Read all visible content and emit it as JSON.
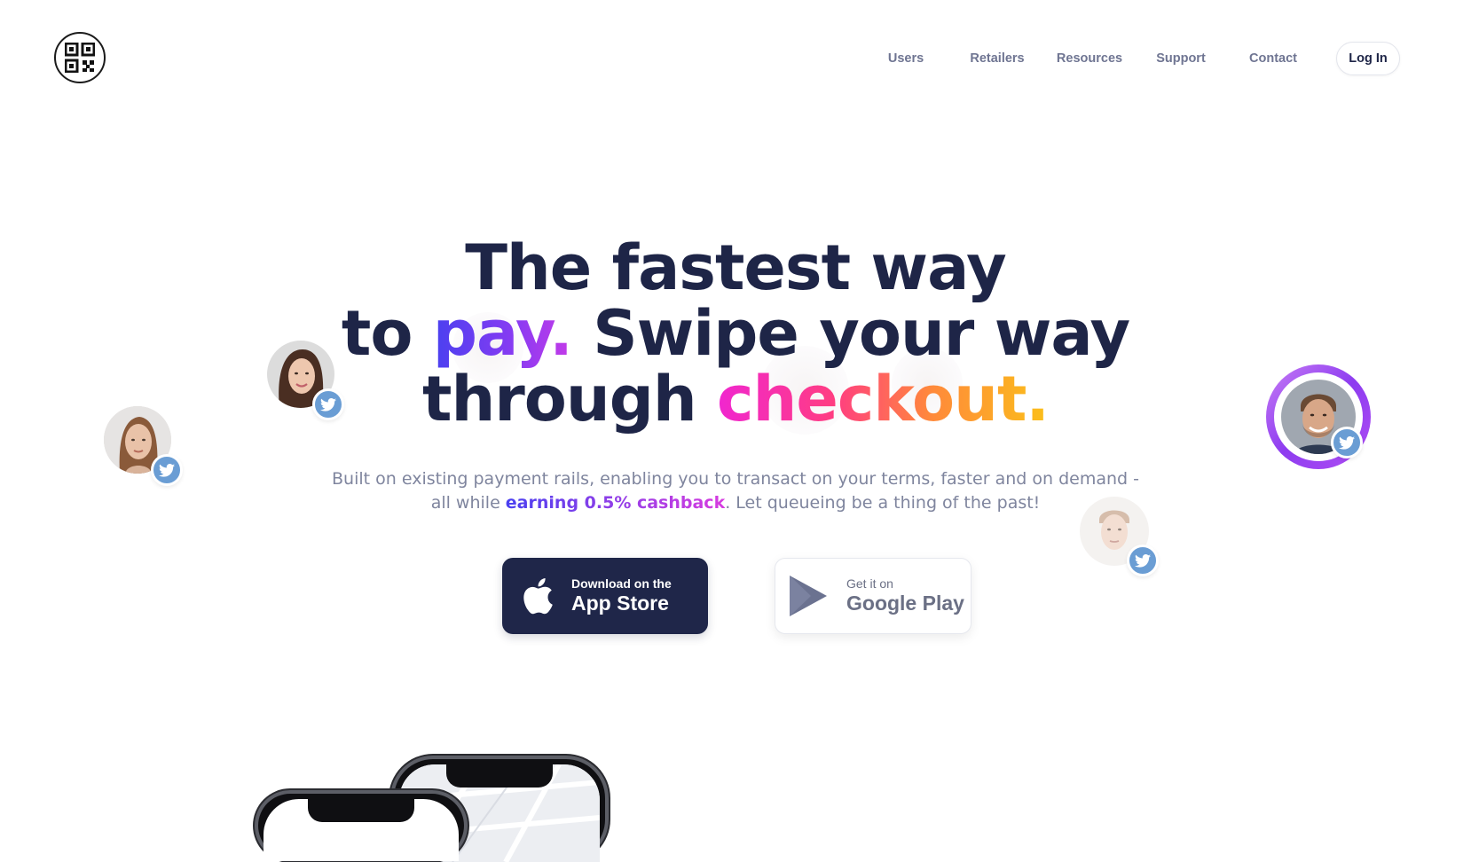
{
  "nav": {
    "items": [
      {
        "label": "Users",
        "name": "nav-users"
      },
      {
        "label": "Retailers",
        "name": "nav-retailers"
      },
      {
        "label": "Resources",
        "name": "nav-resources"
      },
      {
        "label": "Support",
        "name": "nav-support"
      },
      {
        "label": "Contact",
        "name": "nav-contact"
      }
    ],
    "login_label": "Log In"
  },
  "logo": {
    "icon": "qr-code-icon"
  },
  "hero": {
    "line1": "The fastest way",
    "line2_start": "to ",
    "line2_highlight": "pay.",
    "line2_end": " Swipe your way",
    "line3_start": "through ",
    "line3_highlight": "checkout."
  },
  "subtitle": {
    "part1": "Built on existing payment rails, enabling you to transact on your terms, faster and on demand -",
    "part2": "all while ",
    "highlight": "earning 0.5% cashback",
    "part3": ". Let queueing be a thing of the past!"
  },
  "buttons": {
    "appstore": {
      "small": "Download on the",
      "big": "App Store",
      "icon": "apple-icon"
    },
    "google": {
      "small": "Get it on",
      "big": "Google Play",
      "icon": "google-play-icon"
    }
  },
  "avatars": [
    {
      "name": "avatar-woman-left",
      "icon": "twitter-icon"
    },
    {
      "name": "avatar-woman-top",
      "icon": "twitter-icon"
    },
    {
      "name": "avatar-man-right",
      "icon": "twitter-icon"
    },
    {
      "name": "avatar-man-bottom-right",
      "icon": "twitter-icon"
    }
  ],
  "colors": {
    "primary": "#1e2547",
    "nav_text": "#6f7592",
    "twitter": "#6a9dd4",
    "accent_purple": "#8a3bf2",
    "accent_pink": "#f026d0",
    "accent_orange": "#ff8a3a",
    "accent_yellow": "#fbbf1a"
  }
}
